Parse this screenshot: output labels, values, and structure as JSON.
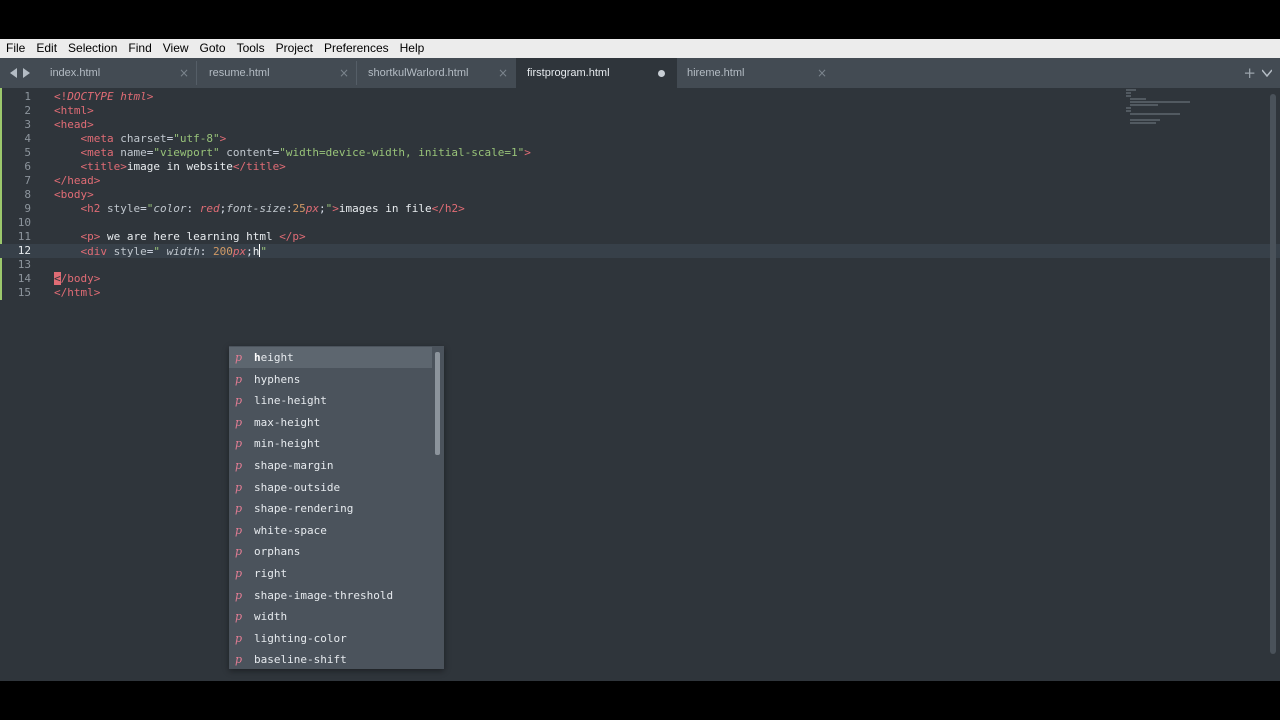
{
  "menu": [
    "File",
    "Edit",
    "Selection",
    "Find",
    "View",
    "Goto",
    "Tools",
    "Project",
    "Preferences",
    "Help"
  ],
  "tabs": [
    {
      "label": "index.html",
      "state": "close"
    },
    {
      "label": "resume.html",
      "state": "close"
    },
    {
      "label": "shortkulWarlord.html",
      "state": "close"
    },
    {
      "label": "firstprogram.html",
      "state": "dirty",
      "active": true
    },
    {
      "label": "hireme.html",
      "state": "close"
    }
  ],
  "icons": {
    "back": "chevron-left-icon",
    "forward": "chevron-right-icon",
    "close": "×",
    "new_tab": "+",
    "tab_menu": "chevron-down-icon"
  },
  "editor": {
    "current_line": 12,
    "lines": [
      {
        "num": "1",
        "text": "<!DOCTYPE html>"
      },
      {
        "num": "2",
        "text": "<html>"
      },
      {
        "num": "3",
        "text": "<head>"
      },
      {
        "num": "4",
        "text": "    <meta charset=\"utf-8\">"
      },
      {
        "num": "5",
        "text": "    <meta name=\"viewport\" content=\"width=device-width, initial-scale=1\">"
      },
      {
        "num": "6",
        "text": "    <title>image in website</title>"
      },
      {
        "num": "7",
        "text": "</head>"
      },
      {
        "num": "8",
        "text": "<body>"
      },
      {
        "num": "9",
        "text": "    <h2 style=\"color: red;font-size:25px;\">images in file</h2>"
      },
      {
        "num": "10",
        "text": ""
      },
      {
        "num": "11",
        "text": "    <p> we are here learning html </p>"
      },
      {
        "num": "12",
        "text": "    <div style=\" width: 200px;h\""
      },
      {
        "num": "13",
        "text": ""
      },
      {
        "num": "14",
        "text": "</body>"
      },
      {
        "num": "15",
        "text": "</html>"
      }
    ]
  },
  "autocomplete": {
    "kind": "p",
    "typed": "h",
    "items": [
      "height",
      "hyphens",
      "line-height",
      "max-height",
      "min-height",
      "shape-margin",
      "shape-outside",
      "shape-rendering",
      "white-space",
      "orphans",
      "right",
      "shape-image-threshold",
      "width",
      "lighting-color",
      "baseline-shift"
    ]
  },
  "colors": {
    "background": "#2f353b",
    "tabbar": "#434b53",
    "tag": "#e06c75",
    "string": "#98c379",
    "number": "#d19a66",
    "autocomplete_bg": "#4b535c",
    "modified_gutter": "#9cc86c"
  }
}
